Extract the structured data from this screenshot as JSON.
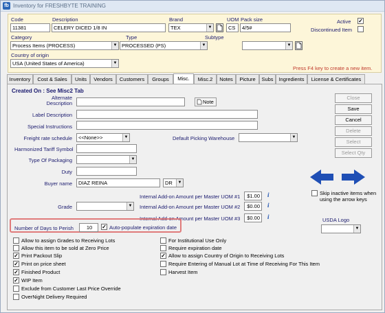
{
  "window": {
    "title": "Inventory for FRESHBYTE TRAINING",
    "icon": "app-logo-icon"
  },
  "header": {
    "code_label": "Code",
    "code_value": "11381",
    "description_label": "Description",
    "description_value": "CELERY DICED 1/8 IN",
    "brand_label": "Brand",
    "brand_value": "TEX",
    "uom_label": "UOM",
    "uom_value": "CS",
    "pack_size_label": "Pack size",
    "pack_size_value": "4/5#",
    "active_label": "Active",
    "active_checked": true,
    "discontinued_label": "Discontinued Item",
    "discontinued_checked": false,
    "category_label": "Category",
    "category_value": "Process Items (PROCESS)",
    "type_label": "Type",
    "type_value": "PROCESSED (PS)",
    "subtype_label": "Subtype",
    "subtype_value": "",
    "country_label": "Country of origin",
    "country_value": "USA (United States of America)",
    "hint": "Press F4 key  to create a new item."
  },
  "tabs": [
    "Inventory",
    "Cost & Sales",
    "Units",
    "Vendors",
    "Customers",
    "Groups",
    "Misc.",
    "Misc.2",
    "Notes",
    "Picture",
    "Subs",
    "Ingredients",
    "License & Certificates"
  ],
  "active_tab": "Misc.",
  "misc": {
    "created_on": "Created On : See Misc2 Tab",
    "alt_desc_label": "Alternate Description",
    "note_button": "Note",
    "label_desc_label": "Label Description",
    "special_label": "Special Instructions",
    "freight_label": "Freight rate schedule",
    "freight_value": "<<None>>",
    "picking_label": "Default Picking Warehouse",
    "tariff_label": "Harmonized Tariff Symbol",
    "packaging_label": "Type Of Packaging",
    "duty_label": "Duty",
    "buyer_label": "Buyer name",
    "buyer_value": "DIAZ REINA",
    "buyer_code": "DR",
    "grade_label": "Grade",
    "addon1_label": "Internal Add-on Amount per Master UOM #1",
    "addon1_value": "$1.00",
    "addon2_label": "Internal Add-on Amount per Master UOM #2",
    "addon2_value": "$0.00",
    "addon3_label": "Internal Add-on Amount per Master UOM #3",
    "addon3_value": "$0.00",
    "perish_label": "Number of Days to Perish",
    "perish_value": "10",
    "autopop_label": "Auto-populate expiration date",
    "skip_label": "Skip inactive items when using the arrow keys",
    "usda_label": "USDA Logo"
  },
  "buttons": {
    "close": "Close",
    "save": "Save",
    "cancel": "Cancel",
    "delete": "Delete",
    "select": "Select",
    "select_qty": "Select Qty"
  },
  "checks_left": [
    {
      "label": "Allow to assign Grades to Receiving Lots",
      "checked": false
    },
    {
      "label": "Allow this item to be sold at Zero Price",
      "checked": false
    },
    {
      "label": "Print Packout Slip",
      "checked": true
    },
    {
      "label": "Print on price sheet",
      "checked": true
    },
    {
      "label": "Finished Product",
      "checked": true
    },
    {
      "label": "WIP Item",
      "checked": true
    },
    {
      "label": "Exclude from Customer Last Price Override",
      "checked": false
    },
    {
      "label": "OverNight Delivery Required",
      "checked": false
    }
  ],
  "checks_right": [
    {
      "label": "For Institutional Use Only",
      "checked": false
    },
    {
      "label": "Require expiration date",
      "checked": false
    },
    {
      "label": "Allow to assign Country of Origin to Receiving Lots",
      "checked": true
    },
    {
      "label": "Require Entering of Manual Lot at Time of Receiving For This Item",
      "checked": false
    },
    {
      "label": "Harvest Item",
      "checked": false
    }
  ],
  "colors": {
    "header_bg": "#fdf6d9",
    "label_blue": "#1a1a6e",
    "hint_red": "#c0392b",
    "highlight": "#e07a7a",
    "arrow_blue": "#1f4fb5"
  }
}
